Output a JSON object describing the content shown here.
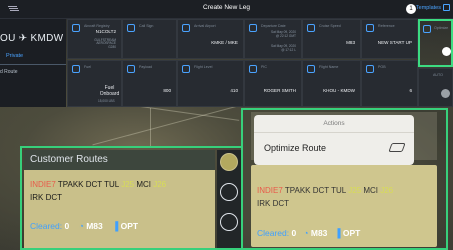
{
  "topbar": {
    "title": "Create New Leg",
    "templates": "Templates",
    "notif_count": "1"
  },
  "route_panel": {
    "origin": "OU",
    "destination": "KMDW",
    "visibility": "Private",
    "add_route": "d Route"
  },
  "cells_row1": [
    {
      "label": "Aircraft Registry",
      "value": "N1COLT2",
      "small": [
        "GULFSTREAM",
        "AEROSPACE",
        "G280"
      ]
    },
    {
      "label": "Call Sign",
      "value": ""
    },
    {
      "label": "Arrival Airport",
      "value": "KMKE / MKE"
    },
    {
      "label": "Departure Date",
      "value": "Sat May 09, 2020",
      "small2": "@ 22:12 GMT",
      "lc": [
        "Sat May 09, 2020",
        "@ 17:12 L"
      ]
    },
    {
      "label": "Cruise Speed",
      "value": "M83"
    },
    {
      "label": "Reference",
      "value": "NEW START UP"
    },
    {
      "label": "Optimize",
      "value": ""
    }
  ],
  "cells_row2": [
    {
      "label": "Fuel",
      "value": "Fuel Onboard",
      "sub": "15,000 LBS"
    },
    {
      "label": "Payload",
      "value": "800"
    },
    {
      "label": "Flight Level",
      "value": "410"
    },
    {
      "label": "PIC",
      "value": "ROGER SMITH"
    },
    {
      "label": "Flight Name",
      "value": "KHOU - KMDW"
    },
    {
      "label": "POB",
      "value": "6"
    },
    {
      "label": "AUTO",
      "value": ""
    }
  ],
  "card_left": {
    "title": "Customer Routes",
    "route_line1": [
      "INDIE7",
      "TPAKK",
      "DCT",
      "TUL",
      "J25",
      "MCI",
      "J26"
    ],
    "route_line2": [
      "IRK",
      "DCT"
    ],
    "cleared_label": "Cleared:",
    "cleared_value": "0",
    "speed": "M83",
    "opt": "OPT"
  },
  "actions": {
    "header": "Actions",
    "item": "Optimize Route"
  },
  "card_right": {
    "title": "Customer Routes",
    "route_line1": [
      "INDIE7",
      "TPAKK",
      "DCT",
      "TUL",
      "J25",
      "MCI",
      "J26"
    ],
    "route_line2": [
      "IRK",
      "DCT"
    ],
    "cleared_label": "Cleared:",
    "cleared_value": "0",
    "speed": "M83",
    "opt": "OPT"
  },
  "colors": {
    "accent_blue": "#4aa3ff",
    "highlight_green": "#37d07b",
    "route_card": "#c9c08a"
  },
  "icons": [
    "filter-icon",
    "airplane-icon",
    "chevron-down-icon",
    "optimize-icon",
    "signal-icon",
    "gauge-icon"
  ]
}
